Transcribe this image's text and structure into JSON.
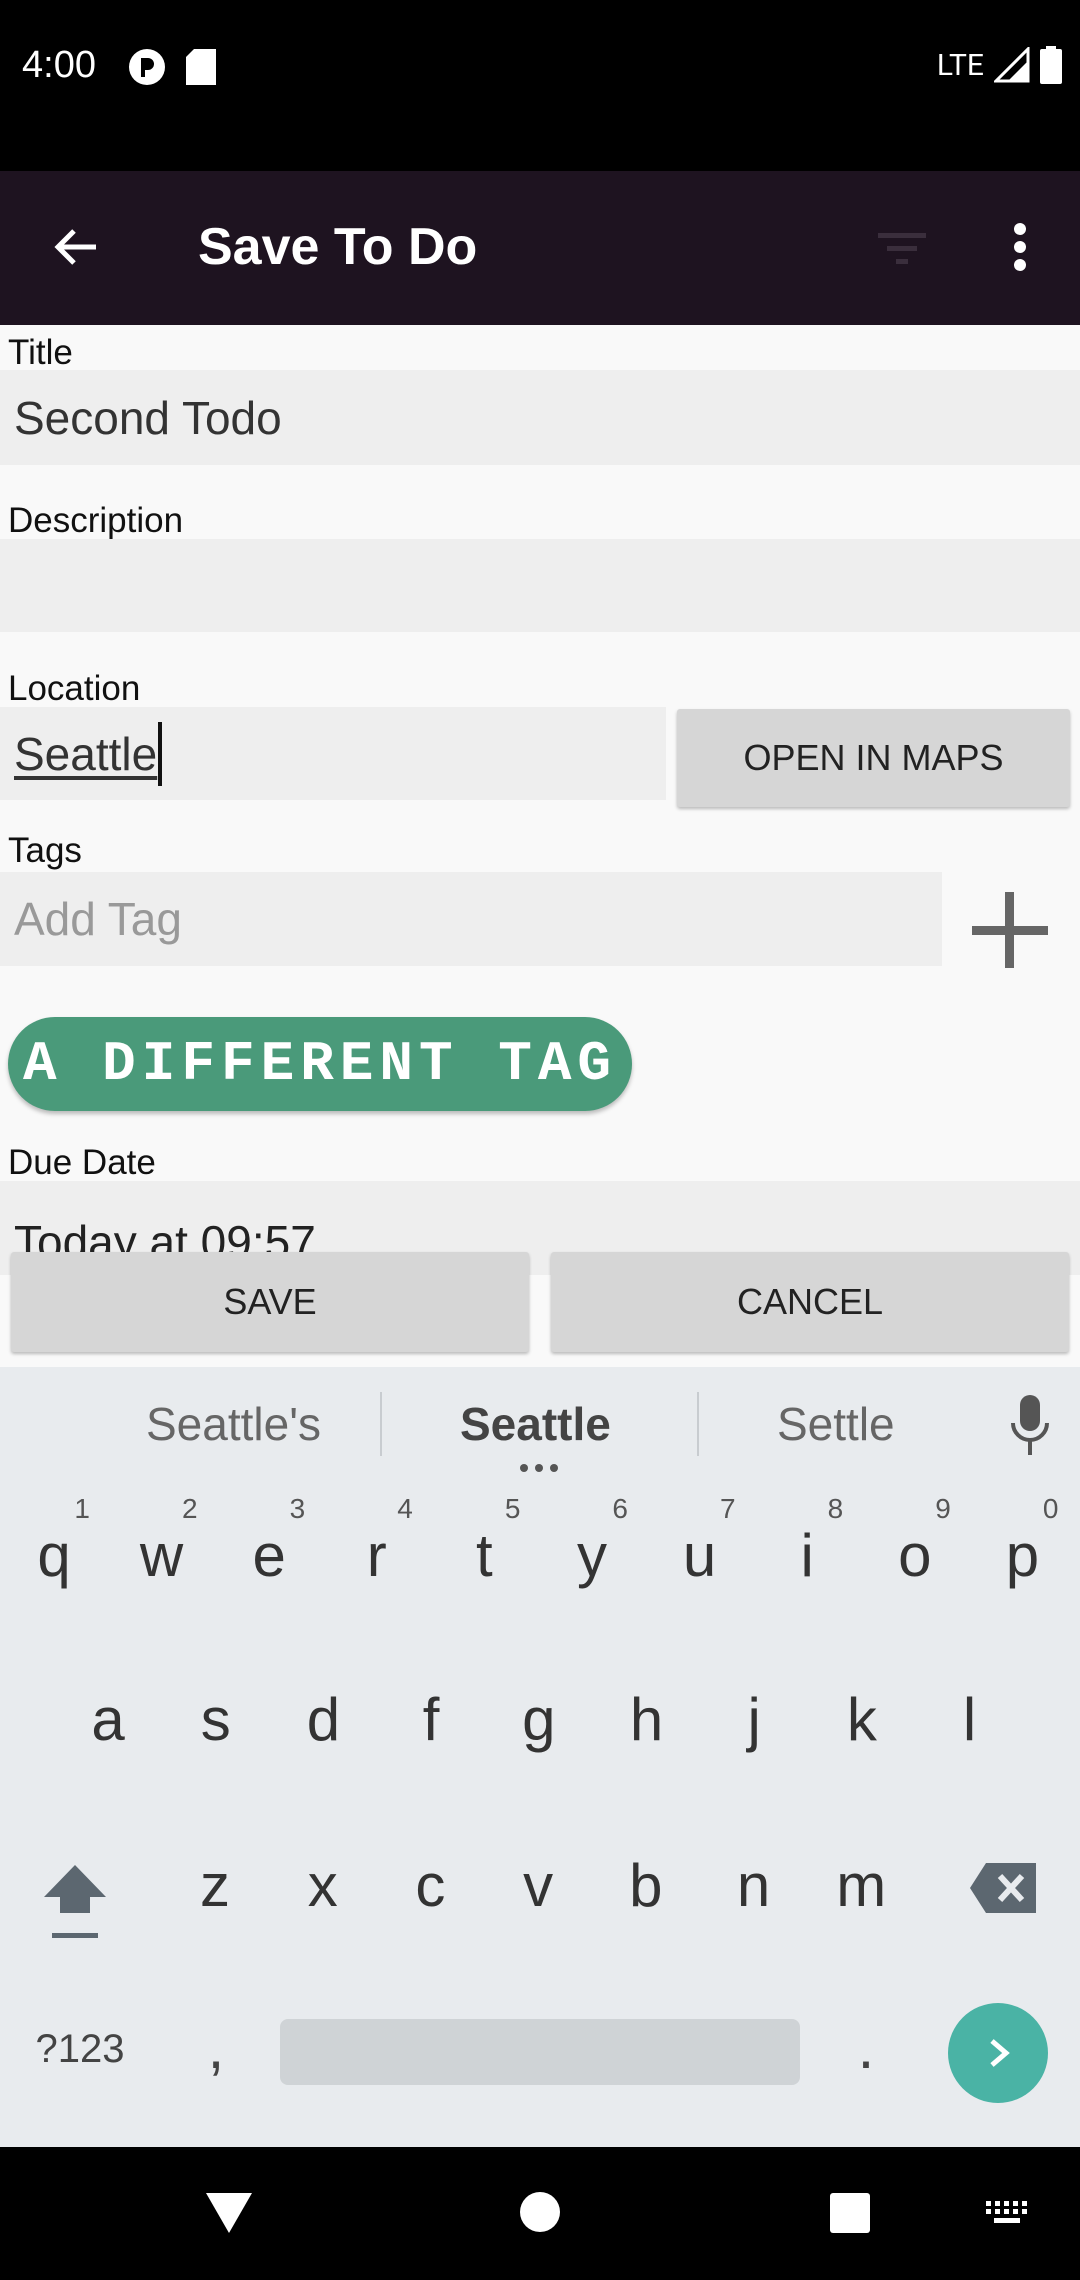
{
  "status_bar": {
    "time": "4:00",
    "network": "LTE"
  },
  "app_bar": {
    "title": "Save To Do"
  },
  "form": {
    "title_label": "Title",
    "title_value": "Second Todo",
    "description_label": "Description",
    "description_value": "",
    "location_label": "Location",
    "location_value": "Seattle",
    "open_in_maps": "OPEN IN MAPS",
    "tags_label": "Tags",
    "tag_placeholder": "Add Tag",
    "tags": [
      "A DIFFERENT TAG"
    ],
    "due_date_label": "Due Date",
    "due_date_value": "Today at 09:57",
    "save": "SAVE",
    "cancel": "CANCEL"
  },
  "keyboard": {
    "suggestions": [
      "Seattle's",
      "Seattle",
      "Settle"
    ],
    "row1": [
      {
        "k": "q",
        "n": "1"
      },
      {
        "k": "w",
        "n": "2"
      },
      {
        "k": "e",
        "n": "3"
      },
      {
        "k": "r",
        "n": "4"
      },
      {
        "k": "t",
        "n": "5"
      },
      {
        "k": "y",
        "n": "6"
      },
      {
        "k": "u",
        "n": "7"
      },
      {
        "k": "i",
        "n": "8"
      },
      {
        "k": "o",
        "n": "9"
      },
      {
        "k": "p",
        "n": "0"
      }
    ],
    "row2": [
      "a",
      "s",
      "d",
      "f",
      "g",
      "h",
      "j",
      "k",
      "l"
    ],
    "row3": [
      "z",
      "x",
      "c",
      "v",
      "b",
      "n",
      "m"
    ],
    "symbols": "?123",
    "comma": ",",
    "period": "."
  }
}
